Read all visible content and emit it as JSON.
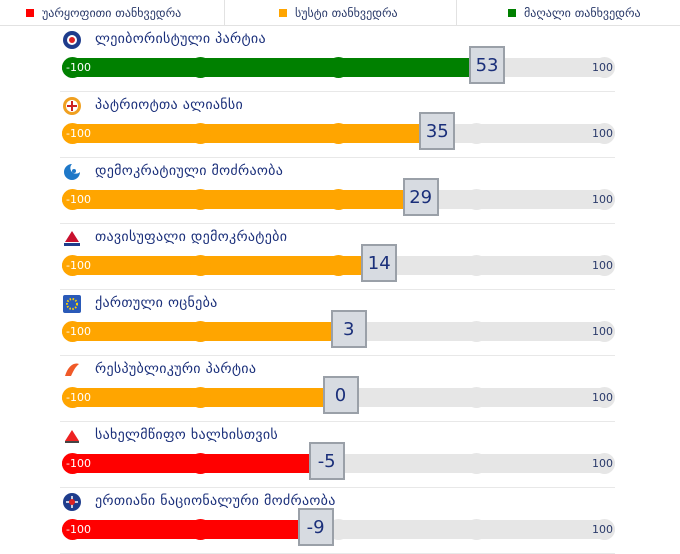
{
  "legend": {
    "items": [
      {
        "label": "უარყოფითი თანხვედრა",
        "color": "#ff0000"
      },
      {
        "label": "სუსტი თანხვედრა",
        "color": "#ffa500"
      },
      {
        "label": "მაღალი თანხვედრა",
        "color": "#008000"
      }
    ]
  },
  "scale": {
    "min_label": "-100",
    "max_label": "100"
  },
  "chart_data": {
    "type": "bar",
    "xlim": [
      -100,
      100
    ],
    "categories": [
      "ლეიბორისტული პარტია",
      "პატრიოტთა ალიანსი",
      "დემოკრატიული მოძრაობა",
      "თავისუფალი დემოკრატები",
      "ქართული ოცნება",
      "რესპუბლიკური პარტია",
      "სახელმწიფო ხალხისთვის",
      "ერთიანი ნაციონალური მოძრაობა"
    ],
    "values": [
      53,
      35,
      29,
      14,
      3,
      0,
      -5,
      -9
    ],
    "labels": [
      "53",
      "35",
      "29",
      "14",
      "3",
      "0",
      "-5",
      "-9"
    ],
    "colors": [
      "#008000",
      "#ffa500",
      "#ffa500",
      "#ffa500",
      "#ffa500",
      "#ffa500",
      "#ff0000",
      "#ff0000"
    ],
    "icons": [
      "labour-party-logo-icon",
      "patriots-alliance-logo-icon",
      "democratic-movement-logo-icon",
      "free-democrats-logo-icon",
      "georgian-dream-logo-icon",
      "republican-party-logo-icon",
      "state-for-people-logo-icon",
      "unm-logo-icon"
    ]
  }
}
